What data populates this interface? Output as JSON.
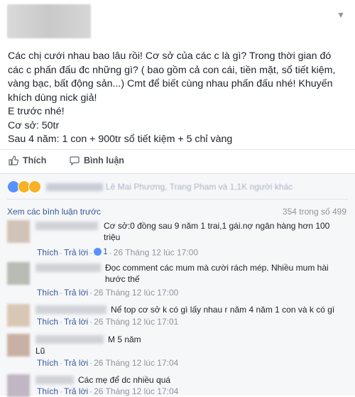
{
  "post": {
    "paragraph_lines": [
      "Các chị cưới nhau bao lâu rồi! Cơ sở của các c là gì? Trong thời gian đó",
      "các c phấn đấu đc những gì? ( bao gồm cả con cái, tiền mặt, sổ tiết kiệm,",
      "vàng bạc, bất động sản...) Cmt để biết cùng nhau phấn đấu nhé! Khuyến",
      "khích dùng nick giả!"
    ],
    "line_e": "E trước nhé!",
    "line_base": "Cơ sở: 50tr",
    "line_after": "Sau 4 năm: 1 con + 900tr sổ tiết kiệm + 5 chỉ vàng",
    "like_label": "Thích",
    "comment_label": "Bình luận"
  },
  "reactions": {
    "names_text": "Lê Mai Phương, Trang Pham và 1,1K người khác"
  },
  "comments_header": {
    "view_previous": "Xem các bình luận trước",
    "count": "354 trong số 499"
  },
  "comments": [
    {
      "text": "Cơ sở:0 đồng sau 9 năm 1 trai,1 gái.nợ ngân hàng hơn 100 triệu",
      "like": "Thích",
      "reply": "Trả lời",
      "likes": "1",
      "time": "26 Tháng 12 lúc 17:00"
    },
    {
      "text": "Đọc comment các mum mà cười rách mép. Nhiều mum hài hước thế",
      "like": "Thích",
      "reply": "Trả lời",
      "time": "26 Tháng 12 lúc 17:00"
    },
    {
      "text": "Nể top cơ sở k có gì lấy nhau r năm 4 năm 1 con và k có gì",
      "like": "Thích",
      "reply": "Trả lời",
      "time": "26 Tháng 12 lúc 17:01"
    },
    {
      "text": "M 5 năm",
      "text2": "Lũ",
      "like": "Thích",
      "reply": "Trả lời",
      "time": "26 Tháng 12 lúc 17:04"
    },
    {
      "text": "Các mẹ để dc nhiều quá",
      "like": "Thích",
      "reply": "Trả lời",
      "time": "26 Tháng 12 lúc 17:04"
    }
  ],
  "colors": {
    "link": "#365899",
    "meta": "#90949c",
    "like_reaction": "#5890ff"
  }
}
